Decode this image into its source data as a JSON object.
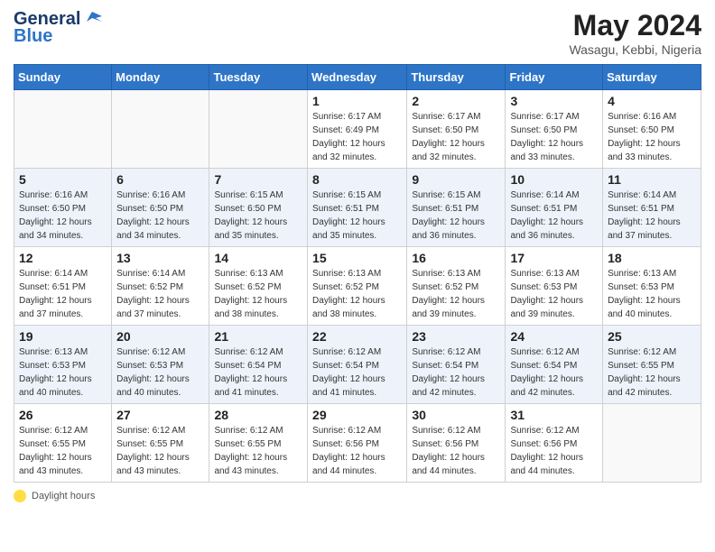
{
  "header": {
    "logo_general": "General",
    "logo_blue": "Blue",
    "month_year": "May 2024",
    "location": "Wasagu, Kebbi, Nigeria"
  },
  "days_of_week": [
    "Sunday",
    "Monday",
    "Tuesday",
    "Wednesday",
    "Thursday",
    "Friday",
    "Saturday"
  ],
  "legend_text": "Daylight hours",
  "weeks": [
    [
      {
        "day": "",
        "info": ""
      },
      {
        "day": "",
        "info": ""
      },
      {
        "day": "",
        "info": ""
      },
      {
        "day": "1",
        "info": "Sunrise: 6:17 AM\nSunset: 6:49 PM\nDaylight: 12 hours\nand 32 minutes."
      },
      {
        "day": "2",
        "info": "Sunrise: 6:17 AM\nSunset: 6:50 PM\nDaylight: 12 hours\nand 32 minutes."
      },
      {
        "day": "3",
        "info": "Sunrise: 6:17 AM\nSunset: 6:50 PM\nDaylight: 12 hours\nand 33 minutes."
      },
      {
        "day": "4",
        "info": "Sunrise: 6:16 AM\nSunset: 6:50 PM\nDaylight: 12 hours\nand 33 minutes."
      }
    ],
    [
      {
        "day": "5",
        "info": "Sunrise: 6:16 AM\nSunset: 6:50 PM\nDaylight: 12 hours\nand 34 minutes."
      },
      {
        "day": "6",
        "info": "Sunrise: 6:16 AM\nSunset: 6:50 PM\nDaylight: 12 hours\nand 34 minutes."
      },
      {
        "day": "7",
        "info": "Sunrise: 6:15 AM\nSunset: 6:50 PM\nDaylight: 12 hours\nand 35 minutes."
      },
      {
        "day": "8",
        "info": "Sunrise: 6:15 AM\nSunset: 6:51 PM\nDaylight: 12 hours\nand 35 minutes."
      },
      {
        "day": "9",
        "info": "Sunrise: 6:15 AM\nSunset: 6:51 PM\nDaylight: 12 hours\nand 36 minutes."
      },
      {
        "day": "10",
        "info": "Sunrise: 6:14 AM\nSunset: 6:51 PM\nDaylight: 12 hours\nand 36 minutes."
      },
      {
        "day": "11",
        "info": "Sunrise: 6:14 AM\nSunset: 6:51 PM\nDaylight: 12 hours\nand 37 minutes."
      }
    ],
    [
      {
        "day": "12",
        "info": "Sunrise: 6:14 AM\nSunset: 6:51 PM\nDaylight: 12 hours\nand 37 minutes."
      },
      {
        "day": "13",
        "info": "Sunrise: 6:14 AM\nSunset: 6:52 PM\nDaylight: 12 hours\nand 37 minutes."
      },
      {
        "day": "14",
        "info": "Sunrise: 6:13 AM\nSunset: 6:52 PM\nDaylight: 12 hours\nand 38 minutes."
      },
      {
        "day": "15",
        "info": "Sunrise: 6:13 AM\nSunset: 6:52 PM\nDaylight: 12 hours\nand 38 minutes."
      },
      {
        "day": "16",
        "info": "Sunrise: 6:13 AM\nSunset: 6:52 PM\nDaylight: 12 hours\nand 39 minutes."
      },
      {
        "day": "17",
        "info": "Sunrise: 6:13 AM\nSunset: 6:53 PM\nDaylight: 12 hours\nand 39 minutes."
      },
      {
        "day": "18",
        "info": "Sunrise: 6:13 AM\nSunset: 6:53 PM\nDaylight: 12 hours\nand 40 minutes."
      }
    ],
    [
      {
        "day": "19",
        "info": "Sunrise: 6:13 AM\nSunset: 6:53 PM\nDaylight: 12 hours\nand 40 minutes."
      },
      {
        "day": "20",
        "info": "Sunrise: 6:12 AM\nSunset: 6:53 PM\nDaylight: 12 hours\nand 40 minutes."
      },
      {
        "day": "21",
        "info": "Sunrise: 6:12 AM\nSunset: 6:54 PM\nDaylight: 12 hours\nand 41 minutes."
      },
      {
        "day": "22",
        "info": "Sunrise: 6:12 AM\nSunset: 6:54 PM\nDaylight: 12 hours\nand 41 minutes."
      },
      {
        "day": "23",
        "info": "Sunrise: 6:12 AM\nSunset: 6:54 PM\nDaylight: 12 hours\nand 42 minutes."
      },
      {
        "day": "24",
        "info": "Sunrise: 6:12 AM\nSunset: 6:54 PM\nDaylight: 12 hours\nand 42 minutes."
      },
      {
        "day": "25",
        "info": "Sunrise: 6:12 AM\nSunset: 6:55 PM\nDaylight: 12 hours\nand 42 minutes."
      }
    ],
    [
      {
        "day": "26",
        "info": "Sunrise: 6:12 AM\nSunset: 6:55 PM\nDaylight: 12 hours\nand 43 minutes."
      },
      {
        "day": "27",
        "info": "Sunrise: 6:12 AM\nSunset: 6:55 PM\nDaylight: 12 hours\nand 43 minutes."
      },
      {
        "day": "28",
        "info": "Sunrise: 6:12 AM\nSunset: 6:55 PM\nDaylight: 12 hours\nand 43 minutes."
      },
      {
        "day": "29",
        "info": "Sunrise: 6:12 AM\nSunset: 6:56 PM\nDaylight: 12 hours\nand 44 minutes."
      },
      {
        "day": "30",
        "info": "Sunrise: 6:12 AM\nSunset: 6:56 PM\nDaylight: 12 hours\nand 44 minutes."
      },
      {
        "day": "31",
        "info": "Sunrise: 6:12 AM\nSunset: 6:56 PM\nDaylight: 12 hours\nand 44 minutes."
      },
      {
        "day": "",
        "info": ""
      }
    ]
  ]
}
